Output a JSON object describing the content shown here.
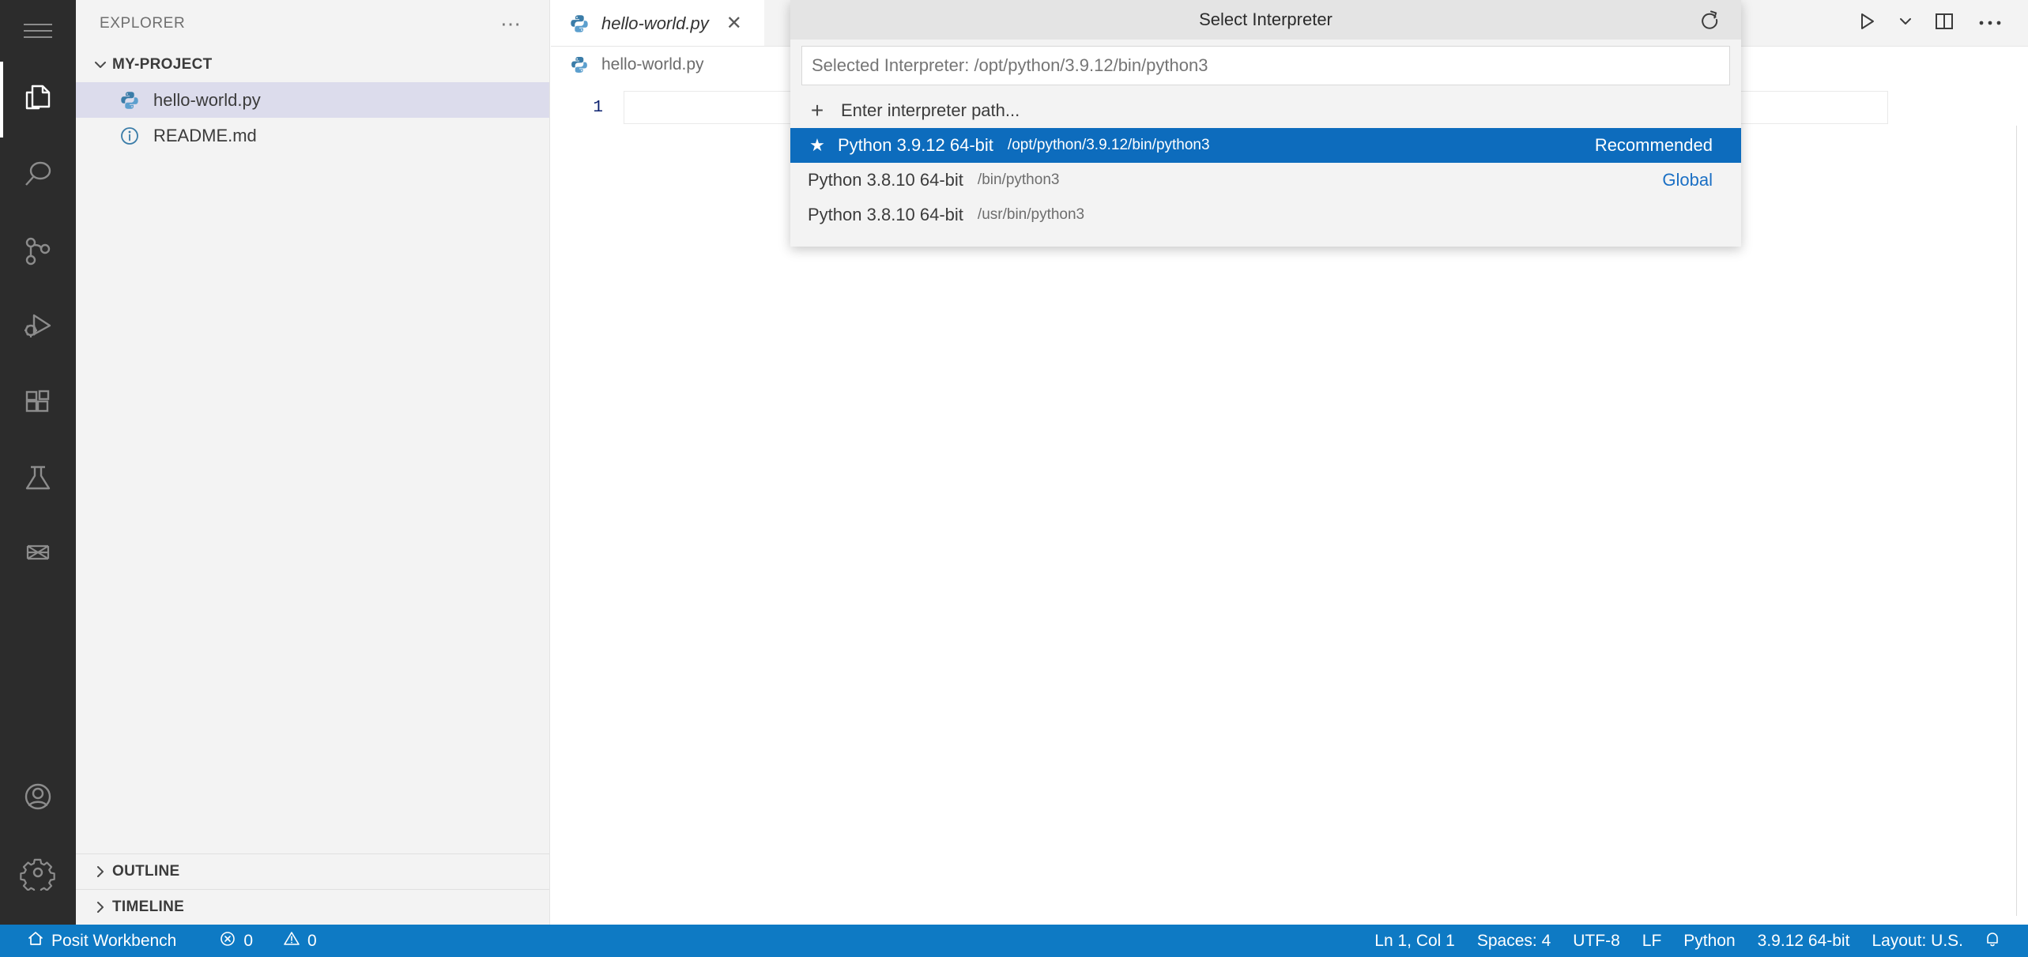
{
  "activity_bar": {
    "items": [
      {
        "name": "menu",
        "icon": "hamburger-menu-icon",
        "active": false
      },
      {
        "name": "explorer",
        "icon": "files-explorer-icon",
        "active": true
      },
      {
        "name": "search",
        "icon": "search-icon",
        "active": false
      },
      {
        "name": "source-control",
        "icon": "source-control-icon",
        "active": false
      },
      {
        "name": "run-and-debug",
        "icon": "run-and-debug-icon",
        "active": false
      },
      {
        "name": "extensions",
        "icon": "extensions-icon",
        "active": false
      },
      {
        "name": "testing",
        "icon": "beaker-testing-icon",
        "active": false
      },
      {
        "name": "connections",
        "icon": "bowtie-connections-icon",
        "active": false
      }
    ],
    "bottom_items": [
      {
        "name": "accounts",
        "icon": "account-person-icon"
      },
      {
        "name": "manage-settings",
        "icon": "gear-settings-icon"
      }
    ]
  },
  "sidebar": {
    "title": "EXPLORER",
    "actions_label": "⋯",
    "folder": {
      "label": "MY-PROJECT",
      "expanded": true,
      "twisty": "chevron-down-icon"
    },
    "files": [
      {
        "label": "hello-world.py",
        "icon": "python-file-icon",
        "selected": true
      },
      {
        "label": "README.md",
        "icon": "markdown-info-icon",
        "selected": false
      }
    ],
    "panels": [
      {
        "label": "OUTLINE",
        "twisty": "chevron-right-icon"
      },
      {
        "label": "TIMELINE",
        "twisty": "chevron-right-icon"
      }
    ]
  },
  "editor": {
    "tab": {
      "label": "hello-world.py",
      "icon": "python-file-icon",
      "close_label": "✕",
      "preview_italic": true
    },
    "tab_actions": [
      {
        "name": "run-python-file",
        "icon": "play-run-icon"
      },
      {
        "name": "run-options-dropdown",
        "icon": "chevron-down-icon"
      },
      {
        "name": "split-editor-right",
        "icon": "split-editor-icon"
      },
      {
        "name": "more-editor-actions",
        "icon": "ellipsis-icon"
      }
    ],
    "breadcrumb": {
      "label": "hello-world.py",
      "icon": "python-file-icon"
    },
    "lines": [
      {
        "number": "1",
        "text": ""
      }
    ]
  },
  "quickpick": {
    "title": "Select Interpreter",
    "refresh_icon": "refresh-icon",
    "input_value": "Selected Interpreter: /opt/python/3.9.12/bin/python3",
    "input_placeholder": "Selected Interpreter: /opt/python/3.9.12/bin/python3",
    "enter_path": {
      "plus": "+",
      "label": "Enter interpreter path..."
    },
    "options": [
      {
        "label": "Python 3.9.12 64-bit",
        "detail": "/opt/python/3.9.12/bin/python3",
        "badge": "Recommended",
        "star": "★",
        "selected": true
      },
      {
        "label": "Python 3.8.10 64-bit",
        "detail": "/bin/python3",
        "badge": "Global",
        "star": "",
        "selected": false
      },
      {
        "label": "Python 3.8.10 64-bit",
        "detail": "/usr/bin/python3",
        "badge": "",
        "star": "",
        "selected": false
      }
    ]
  },
  "statusbar": {
    "background": "#0e7ac4",
    "left": [
      {
        "name": "remote-host",
        "icon": "home-icon",
        "label": "Posit Workbench"
      },
      {
        "name": "problems-errors",
        "icon": "error-circle-icon",
        "label": "0"
      },
      {
        "name": "problems-warnings",
        "icon": "warning-triangle-icon",
        "label": "0"
      }
    ],
    "right": [
      {
        "name": "editor-position",
        "label": "Ln 1, Col 1"
      },
      {
        "name": "editor-indentation",
        "label": "Spaces: 4"
      },
      {
        "name": "editor-encoding",
        "label": "UTF-8"
      },
      {
        "name": "editor-eol",
        "label": "LF"
      },
      {
        "name": "editor-language",
        "label": "Python"
      },
      {
        "name": "python-interpreter",
        "label": "3.9.12 64-bit"
      },
      {
        "name": "keyboard-layout",
        "label": "Layout: U.S."
      },
      {
        "name": "notifications",
        "icon": "bell-icon",
        "label": ""
      }
    ]
  }
}
